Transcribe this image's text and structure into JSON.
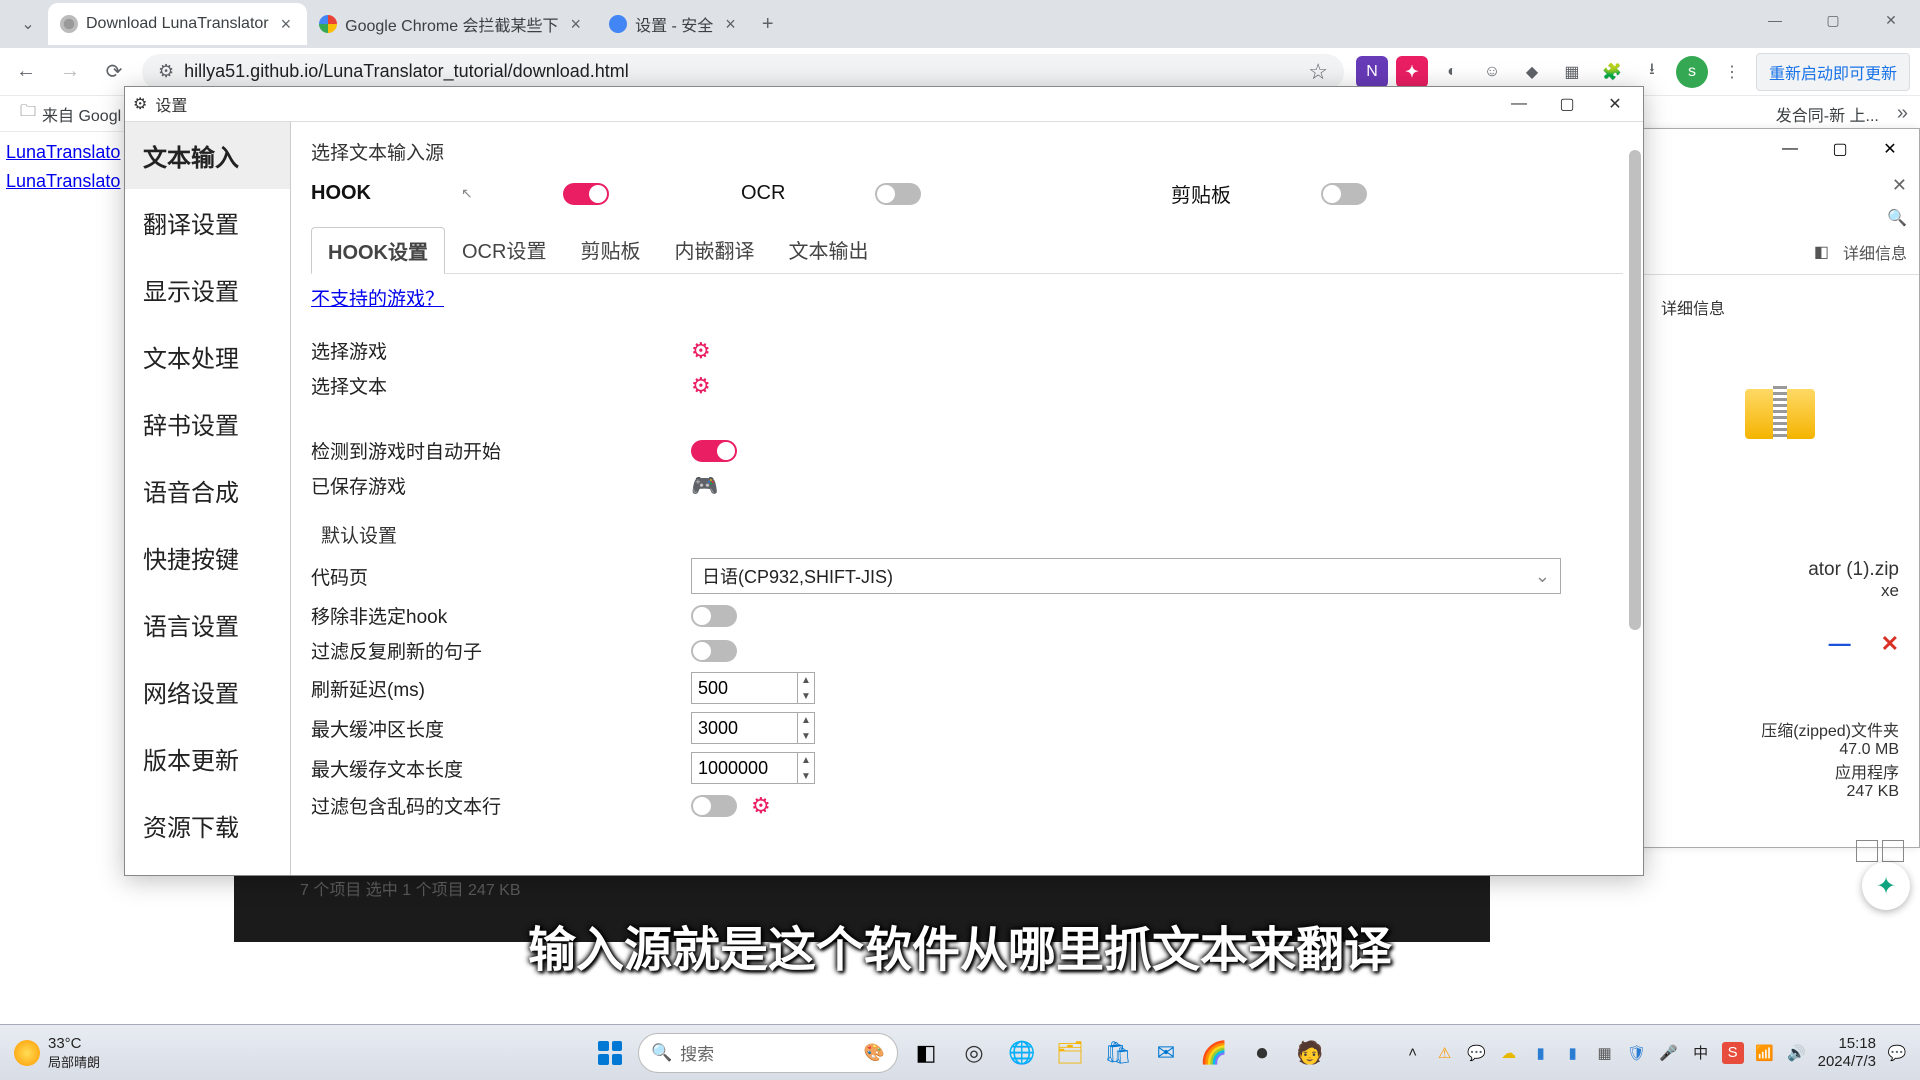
{
  "browser": {
    "tabs": [
      {
        "title": "Download LunaTranslator",
        "active": true
      },
      {
        "title": "Google Chrome 会拦截某些下",
        "active": false
      },
      {
        "title": "设置 - 安全",
        "active": false
      }
    ],
    "url": "hillya51.github.io/LunaTranslator_tutorial/download.html",
    "restart_label": "重新启动即可更新",
    "bookmark1_label": "来自 Googl",
    "bookmark_right": "发合同-新 上...",
    "avatar_letter": "s"
  },
  "page_links": {
    "l1": "LunaTranslato",
    "l2": "LunaTranslato"
  },
  "settings": {
    "title": "设置",
    "sidebar": {
      "items": [
        "文本输入",
        "翻译设置",
        "显示设置",
        "文本处理",
        "辞书设置",
        "语音合成",
        "快捷按键",
        "语言设置",
        "网络设置",
        "版本更新",
        "资源下载"
      ],
      "active": 0
    },
    "section_source": "选择文本输入源",
    "sources": {
      "hook": {
        "label": "HOOK",
        "on": true
      },
      "ocr": {
        "label": "OCR",
        "on": false
      },
      "clip": {
        "label": "剪贴板",
        "on": false
      }
    },
    "subtabs": [
      "HOOK设置",
      "OCR设置",
      "剪贴板",
      "内嵌翻译",
      "文本输出"
    ],
    "subtab_active": 0,
    "unsupported_link": "不支持的游戏？",
    "rows": {
      "select_game": "选择游戏",
      "select_text": "选择文本",
      "auto_start": "检测到游戏时自动开始",
      "auto_start_on": true,
      "saved_games": "已保存游戏"
    },
    "defaults": {
      "title": "默认设置",
      "codepage_label": "代码页",
      "codepage_value": "日语(CP932,SHIFT-JIS)",
      "remove_unselected_label": "移除非选定hook",
      "remove_unselected_on": false,
      "filter_refresh_label": "过滤反复刷新的句子",
      "filter_refresh_on": false,
      "refresh_delay_label": "刷新延迟(ms)",
      "refresh_delay_value": "500",
      "max_buffer_label": "最大缓冲区长度",
      "max_buffer_value": "3000",
      "max_cache_label": "最大缓存文本长度",
      "max_cache_value": "1000000",
      "filter_garbage_label": "过滤包含乱码的文本行",
      "filter_garbage_on": false
    }
  },
  "status_strip": "7 个项目    选中 1 个项目  247 KB",
  "explorer": {
    "detail_btn": "详细信息",
    "detail_btn2": "详细信息",
    "filename": "ator (1).zip",
    "line2": "xe",
    "type_label": "压缩(zipped)文件夹",
    "size": "47.0 MB",
    "app_label": "应用程序",
    "size2": "247 KB",
    "close_red": "✕",
    "min_blue": "—"
  },
  "subtitle": "输入源就是这个软件从哪里抓文本来翻译",
  "taskbar": {
    "temp": "33°C",
    "cond": "局部晴朗",
    "search_placeholder": "搜索",
    "time": "15:18",
    "date": "2024/7/3",
    "ime": "中"
  }
}
